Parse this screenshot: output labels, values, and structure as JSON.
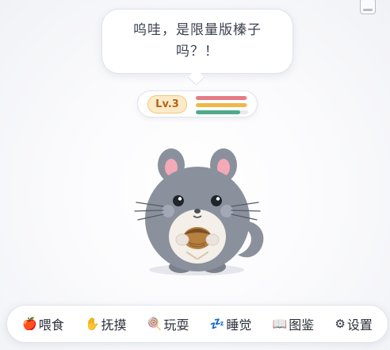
{
  "speech_bubble": {
    "text": "呜哇，是限量版榛子吗？！"
  },
  "status": {
    "level": "Lv.3",
    "bars": [
      {
        "name": "hunger",
        "fill": 0.97,
        "color": "#e47b86"
      },
      {
        "name": "mood",
        "fill": 0.97,
        "color": "#f0b849"
      },
      {
        "name": "energy",
        "fill": 0.85,
        "color": "#4fa98a"
      }
    ]
  },
  "pet": {
    "kind": "chinchilla",
    "holding": "hazelnut",
    "colors": {
      "fur": "#8a919d",
      "belly": "#f4efe8",
      "ear_inner": "#f3a9b6",
      "nut": "#b6803f"
    }
  },
  "toolbar": {
    "items": [
      {
        "id": "feed",
        "icon": "apple-icon",
        "glyph": "🍎",
        "label": "喂食"
      },
      {
        "id": "pet",
        "icon": "hand-icon",
        "glyph": "✋",
        "label": "抚摸"
      },
      {
        "id": "play",
        "icon": "lollipop-icon",
        "glyph": "🍭",
        "label": "玩耍"
      },
      {
        "id": "sleep",
        "icon": "zzz-icon",
        "glyph": "💤",
        "label": "睡觉"
      },
      {
        "id": "album",
        "icon": "book-icon",
        "glyph": "📖",
        "label": "图鉴"
      },
      {
        "id": "settings",
        "icon": "gear-icon",
        "glyph": "⚙",
        "label": "设置"
      }
    ]
  }
}
